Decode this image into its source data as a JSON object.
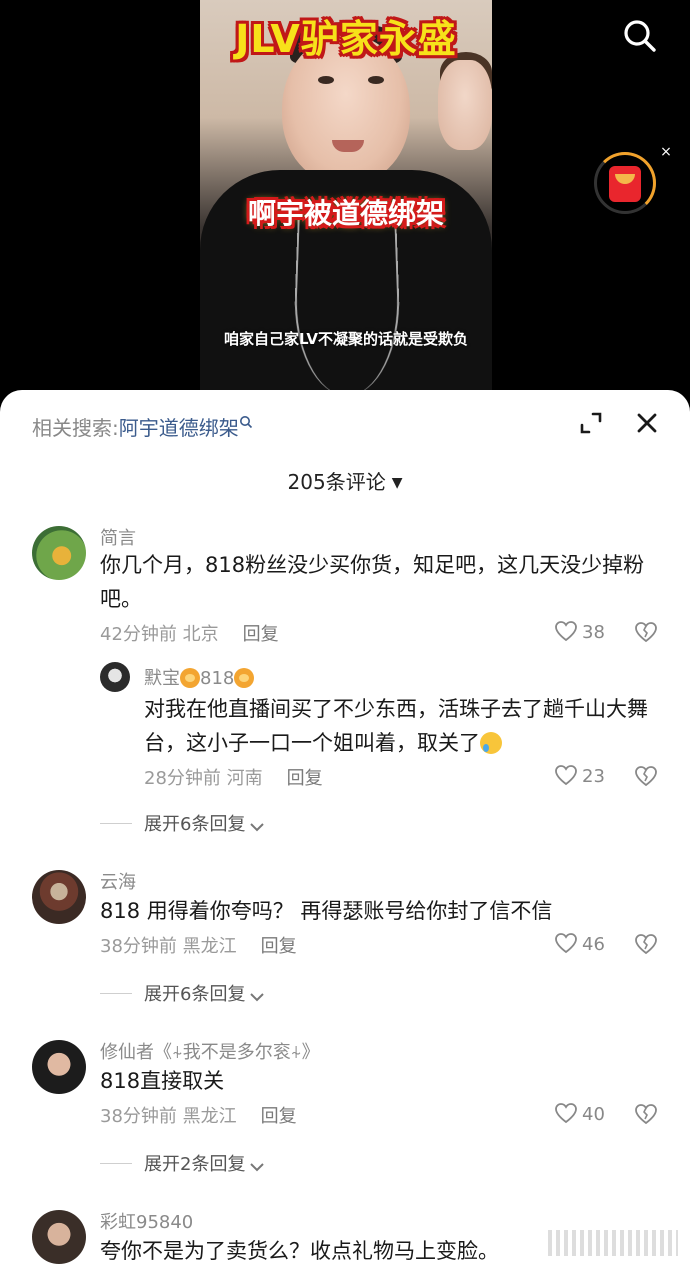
{
  "video": {
    "title": "JLV驴家永盛",
    "caption": "啊宇被道德绑架",
    "subtitle": "咱家自己家LV不凝聚的话就是受欺负"
  },
  "icons": {
    "search": "search-icon",
    "red_packet": "red-packet-icon",
    "close_small": "close-icon",
    "expand": "expand-icon",
    "close": "close-icon",
    "heart": "heart-icon",
    "dislike": "broken-heart-icon"
  },
  "close_small_glyph": "×",
  "sheet": {
    "related_label": "相关搜索:",
    "related_query": "阿宇道德绑架",
    "comment_count": "205条评论",
    "count_arrow": "▼"
  },
  "comments": [
    {
      "user": "简言",
      "text": "你几个月，818粉丝没少买你货，知足吧，这几天没少掉粉吧。",
      "time_loc": "42分钟前 北京",
      "reply": "回复",
      "likes": "38",
      "replies": [
        {
          "user": "默宝",
          "user_suffix": "818",
          "text": "对我在他直播间买了不少东西，活珠子去了趟千山大舞台，这小子一口一个姐叫着，取关了",
          "time_loc": "28分钟前 河南",
          "reply": "回复",
          "likes": "23"
        }
      ],
      "expand": "展开6条回复"
    },
    {
      "user": "云海",
      "text": "818 用得着你夸吗？ 再得瑟账号给你封了信不信",
      "time_loc": "38分钟前 黑龙江",
      "reply": "回复",
      "likes": "46",
      "expand": "展开6条回复"
    },
    {
      "user": "修仙者《⍭我不是多尔衮⍭》",
      "text": "818直接取关",
      "time_loc": "38分钟前 黑龙江",
      "reply": "回复",
      "likes": "40",
      "expand": "展开2条回复"
    },
    {
      "user": "彩虹95840",
      "text": "夸你不是为了卖货么？收点礼物马上变脸。"
    }
  ]
}
